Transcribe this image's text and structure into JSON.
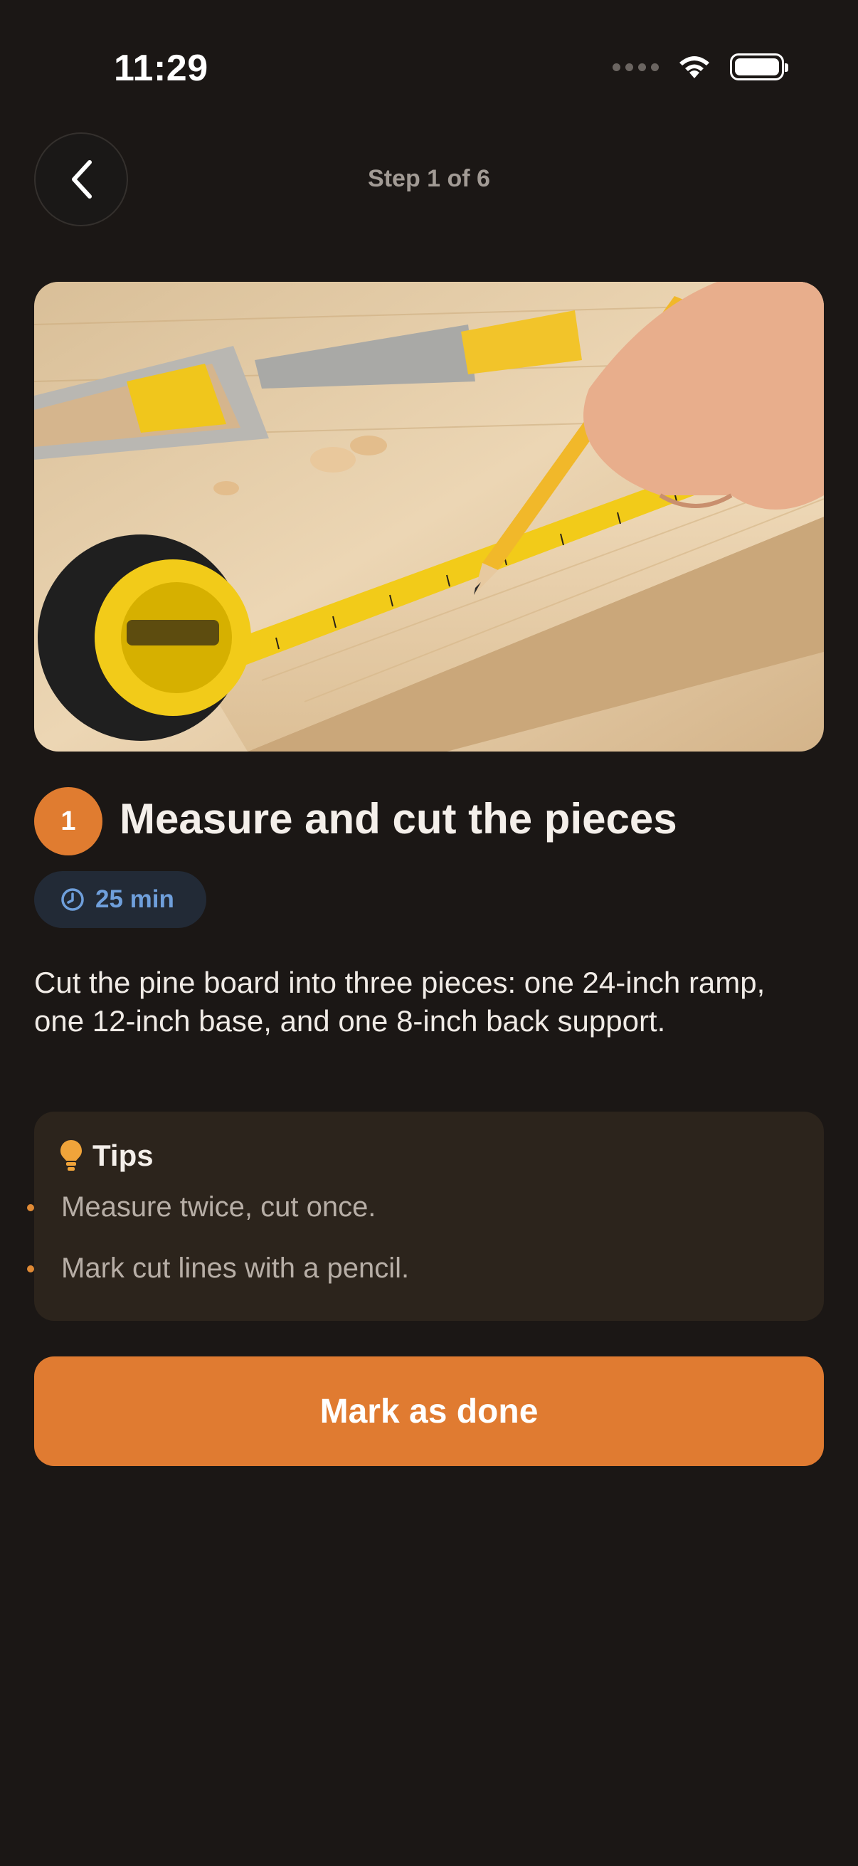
{
  "status_bar": {
    "time": "11:29"
  },
  "header": {
    "step_label": "Step 1 of 6"
  },
  "step": {
    "number": "1",
    "title": "Measure and cut the pieces",
    "duration": "25 min",
    "description": "Cut the pine board into three pieces: one 24-inch ramp, one 12-inch base, and one 8-inch back support."
  },
  "tips": {
    "title": "Tips",
    "items": [
      "Measure twice, cut once.",
      "Mark cut lines with a pencil."
    ]
  },
  "actions": {
    "mark_done_label": "Mark as done"
  },
  "colors": {
    "background": "#1b1715",
    "accent": "#e07b31",
    "duration_text": "#6f9fdb",
    "tips_background": "#2c241c"
  },
  "icons": [
    "chevron-left-icon",
    "clock-icon",
    "lightbulb-icon",
    "wifi-icon",
    "battery-icon"
  ]
}
